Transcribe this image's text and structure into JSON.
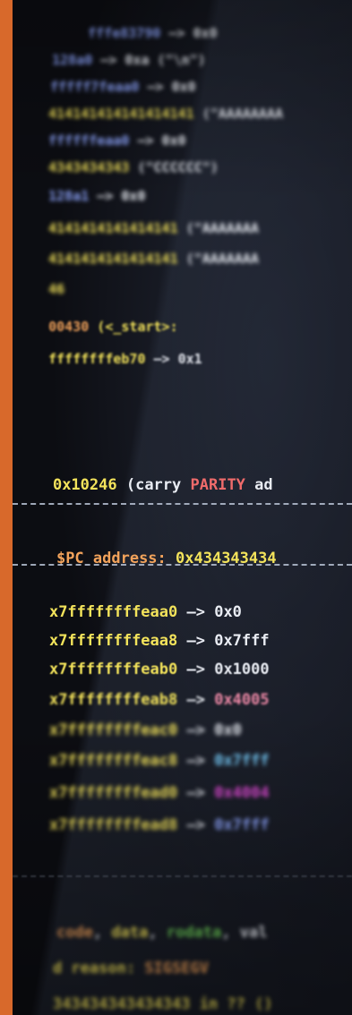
{
  "image": {
    "accent_strip_color": "#d8692b",
    "top_lines": [
      {
        "a": "fffe83790",
        "b": " —> 0x0"
      },
      {
        "a": "128a0",
        "b": " —> 0xa (\"\\n\")"
      },
      {
        "a": "fffff7feaa0",
        "b": " —> 0x0"
      },
      {
        "a": "414141414141414141",
        "b": " (\"AAAAAAAA"
      },
      {
        "a": "ffffffeaa0",
        "b": " —> 0x0"
      },
      {
        "a": "4343434343",
        "b": " (\"CCCCCC\")"
      },
      {
        "a": "128a1",
        "b": " —> 0x0"
      },
      {
        "a": "4141414141414141",
        "b": " (\"AAAAAAA"
      },
      {
        "a": "4141414141414141",
        "b": " (\"AAAAAAA"
      },
      {
        "a": "46",
        "b": ""
      },
      {
        "a": "00430",
        "b": " (<_start>:"
      },
      {
        "a": "ffffffffeb70",
        "b": " —> 0x1"
      }
    ],
    "flags_line": {
      "addr": "0x10246",
      "open": " (carry ",
      "parity": "PARITY",
      "rest": " ad"
    },
    "pc_line": {
      "label": "$PC address:",
      "value": " 0x434343434"
    },
    "stack_lines": [
      {
        "addr": "x7ffffffffeaa0",
        "arrow": " —> ",
        "val": "0x0"
      },
      {
        "addr": "x7ffffffffeaa8",
        "arrow": " —> ",
        "val": "0x7fff"
      },
      {
        "addr": "x7ffffffffeab0",
        "arrow": " —> ",
        "val": "0x1000"
      },
      {
        "addr": "x7ffffffffeab8",
        "arrow": " —> ",
        "val": "0x4005"
      },
      {
        "addr": "x7ffffffffeac0",
        "arrow": " —> ",
        "val": "0x0"
      },
      {
        "addr": "x7ffffffffeac8",
        "arrow": " —> ",
        "val": "0x7fff"
      },
      {
        "addr": "x7ffffffffead0",
        "arrow": " —> ",
        "val": "0x4004"
      },
      {
        "addr": "x7ffffffffead8",
        "arrow": " —> ",
        "val": "0x7fff"
      }
    ],
    "legend_line": {
      "code": "code",
      "data": "data",
      "rodata": "rodata",
      "tail": ", val"
    },
    "reason_line": {
      "label": "d reason:",
      "value": " SIGSEGV"
    },
    "bottom_line": {
      "text": "343434343434343 in ?? ()"
    }
  }
}
